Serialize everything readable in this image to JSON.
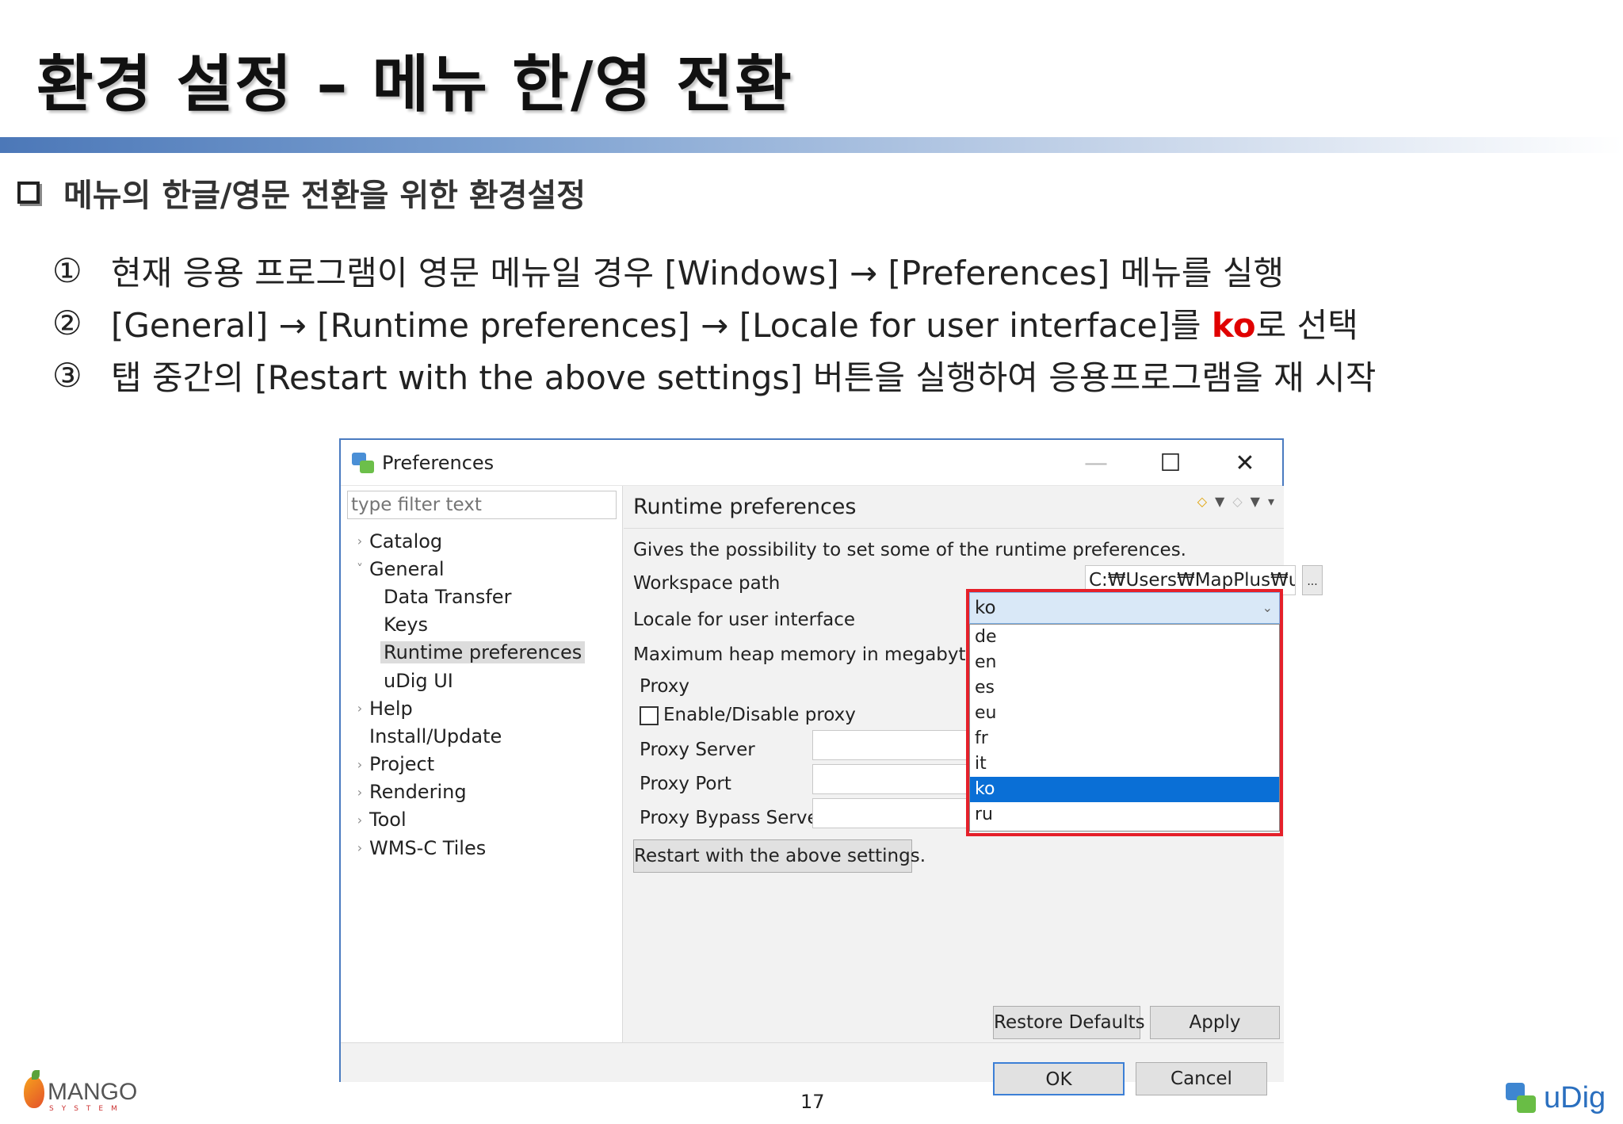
{
  "slide": {
    "title": "환경 설정 – 메뉴 한/영 전환",
    "section": "메뉴의 한글/영문 전환을 위한 환경설정",
    "steps": [
      {
        "num": "①",
        "pre": "현재 응용 프로그램이 영문 메뉴일 경우 [Windows] → [Preferences] 메뉴를 실행",
        "hl": "",
        "post": ""
      },
      {
        "num": "②",
        "pre": "[General] → [Runtime preferences] → [Locale for user interface]를 ",
        "hl": "ko",
        "post": "로 선택"
      },
      {
        "num": "③",
        "pre": "탭 중간의 [Restart with the above settings] 버튼을 실행하여 응용프로그램을 재 시작",
        "hl": "",
        "post": ""
      }
    ],
    "page_number": "17",
    "footer_left_logo": "MANGO",
    "footer_left_sub": "SYSTEM",
    "footer_right_logo": "uDig"
  },
  "window": {
    "title": "Preferences",
    "controls": {
      "minimize": "—",
      "maximize": "☐",
      "close": "✕"
    },
    "filter_placeholder": "type filter text",
    "tree": [
      {
        "label": "Catalog",
        "arrow": "›",
        "level": 1
      },
      {
        "label": "General",
        "arrow": "˅",
        "level": 1
      },
      {
        "label": "Data Transfer",
        "arrow": "",
        "level": 2
      },
      {
        "label": "Keys",
        "arrow": "",
        "level": 2
      },
      {
        "label": "Runtime preferences",
        "arrow": "",
        "level": 2,
        "selected": true
      },
      {
        "label": "uDig UI",
        "arrow": "",
        "level": 2
      },
      {
        "label": "Help",
        "arrow": "›",
        "level": 1
      },
      {
        "label": "Install/Update",
        "arrow": "",
        "level": 1
      },
      {
        "label": "Project",
        "arrow": "›",
        "level": 1
      },
      {
        "label": "Rendering",
        "arrow": "›",
        "level": 1
      },
      {
        "label": "Tool",
        "arrow": "›",
        "level": 1
      },
      {
        "label": "WMS-C Tiles",
        "arrow": "›",
        "level": 1
      }
    ],
    "page": {
      "heading": "Runtime preferences",
      "description": "Gives the possibility to set some of the runtime preferences.",
      "workspace_label": "Workspace path",
      "workspace_value": "C:₩Users₩MapPlus₩uDig",
      "browse_label": "...",
      "locale_label": "Locale for user interface",
      "locale_value": "ko",
      "heap_label": "Maximum heap memory in megabytes",
      "proxy_group": "Proxy",
      "proxy_checkbox": "Enable/Disable proxy",
      "proxy_server_label": "Proxy Server",
      "proxy_port_label": "Proxy Port",
      "proxy_bypass_label": "Proxy Bypass Servers",
      "restart_button": "Restart with the above settings.",
      "restore_button": "Restore Defaults",
      "apply_button": "Apply"
    },
    "locale_options": [
      "de",
      "en",
      "es",
      "eu",
      "fr",
      "it",
      "ko",
      "ru"
    ],
    "locale_selected": "ko",
    "ok_button": "OK",
    "cancel_button": "Cancel"
  }
}
